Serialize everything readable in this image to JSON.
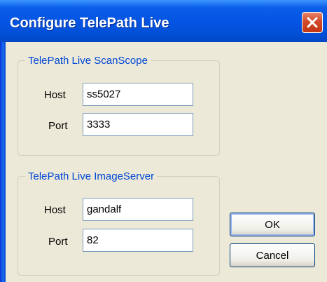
{
  "window": {
    "title": "Configure TelePath Live"
  },
  "scanscope_group": {
    "legend": "TelePath Live ScanScope",
    "host_label": "Host",
    "host_value": "ss5027",
    "port_label": "Port",
    "port_value": "3333"
  },
  "imageserver_group": {
    "legend": "TelePath Live ImageServer",
    "host_label": "Host",
    "host_value": "gandalf",
    "port_label": "Port",
    "port_value": "82"
  },
  "buttons": {
    "ok_label": "OK",
    "cancel_label": "Cancel"
  },
  "colors": {
    "title_bar": "#0554e3",
    "group_legend": "#0046d5",
    "dialog_background": "#ece9d8",
    "close_button": "#d24a28"
  },
  "icons": {
    "close": "close-icon"
  }
}
